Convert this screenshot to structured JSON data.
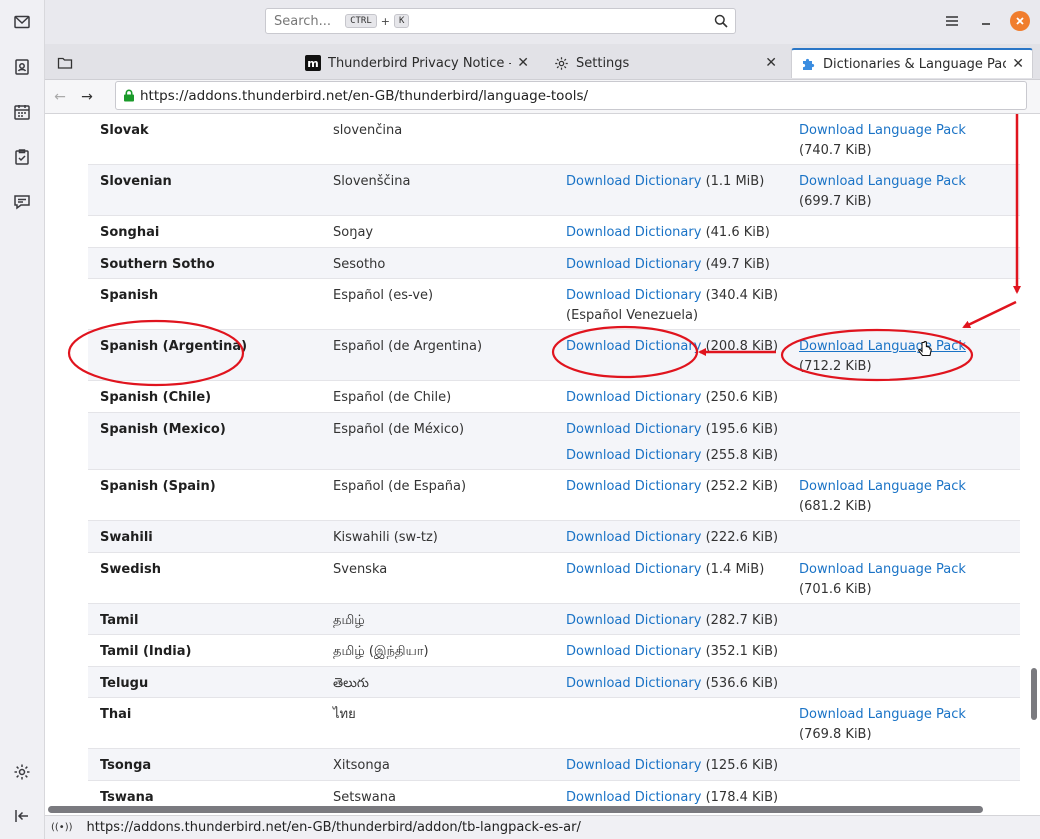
{
  "search": {
    "placeholder": "Search...",
    "key1": "CTRL",
    "plus": "+",
    "key2": "K"
  },
  "tabs": [
    {
      "label": "Thunderbird Privacy Notice — M",
      "icon": "m"
    },
    {
      "label": "Settings"
    },
    {
      "label": "Dictionaries & Language Packs"
    }
  ],
  "urlbar": {
    "url": "https://addons.thunderbird.net/en-GB/thunderbird/language-tools/"
  },
  "status": {
    "url": "https://addons.thunderbird.net/en-GB/thunderbird/addon/tb-langpack-es-ar/"
  },
  "link_labels": {
    "dictionary": "Download Dictionary",
    "pack": "Download Language Pack"
  },
  "rows": [
    {
      "lang": "Slovak",
      "native": "slovenčina",
      "dict": [],
      "pack": "(740.7 KiB)"
    },
    {
      "lang": "Slovenian",
      "native": "Slovenščina",
      "dict": [
        "(1.1 MiB)"
      ],
      "pack": "(699.7 KiB)"
    },
    {
      "lang": "Songhai",
      "native": "Soŋay",
      "dict": [
        "(41.6 KiB)"
      ],
      "pack": ""
    },
    {
      "lang": "Southern Sotho",
      "native": "Sesotho",
      "dict": [
        "(49.7 KiB)"
      ],
      "pack": ""
    },
    {
      "lang": "Spanish",
      "native": "Español (es-ve)",
      "dict": [
        "(340.4 KiB)"
      ],
      "dict_note": "(Español Venezuela)",
      "pack": ""
    },
    {
      "lang": "Spanish (Argentina)",
      "native": "Español (de Argentina)",
      "dict": [
        "(200.8 KiB)"
      ],
      "pack": "(712.2 KiB)"
    },
    {
      "lang": "Spanish (Chile)",
      "native": "Español (de Chile)",
      "dict": [
        "(250.6 KiB)"
      ],
      "pack": ""
    },
    {
      "lang": "Spanish (Mexico)",
      "native": "Español (de México)",
      "dict": [
        "(195.6 KiB)",
        "(255.8 KiB)"
      ],
      "pack": ""
    },
    {
      "lang": "Spanish (Spain)",
      "native": "Español (de España)",
      "dict": [
        "(252.2 KiB)"
      ],
      "pack": "(681.2 KiB)"
    },
    {
      "lang": "Swahili",
      "native": "Kiswahili (sw-tz)",
      "dict": [
        "(222.6 KiB)"
      ],
      "pack": ""
    },
    {
      "lang": "Swedish",
      "native": "Svenska",
      "dict": [
        "(1.4 MiB)"
      ],
      "pack": "(701.6 KiB)"
    },
    {
      "lang": "Tamil",
      "native": "தமிழ்",
      "dict": [
        "(282.7 KiB)"
      ],
      "pack": ""
    },
    {
      "lang": "Tamil (India)",
      "native": "தமிழ் (இந்தியா)",
      "dict": [
        "(352.1 KiB)"
      ],
      "pack": ""
    },
    {
      "lang": "Telugu",
      "native": "తెలుగు",
      "dict": [
        "(536.6 KiB)"
      ],
      "pack": ""
    },
    {
      "lang": "Thai",
      "native": "ไทย",
      "dict": [],
      "pack": "(769.8 KiB)"
    },
    {
      "lang": "Tsonga",
      "native": "Xitsonga",
      "dict": [
        "(125.6 KiB)"
      ],
      "pack": ""
    },
    {
      "lang": "Tswana",
      "native": "Setswana",
      "dict": [
        "(178.4 KiB)"
      ],
      "pack": ""
    }
  ],
  "colors": {
    "link": "#1a73c6",
    "annotation": "#e0141e",
    "accent": "#2a76c6",
    "close": "#f07d2d"
  }
}
